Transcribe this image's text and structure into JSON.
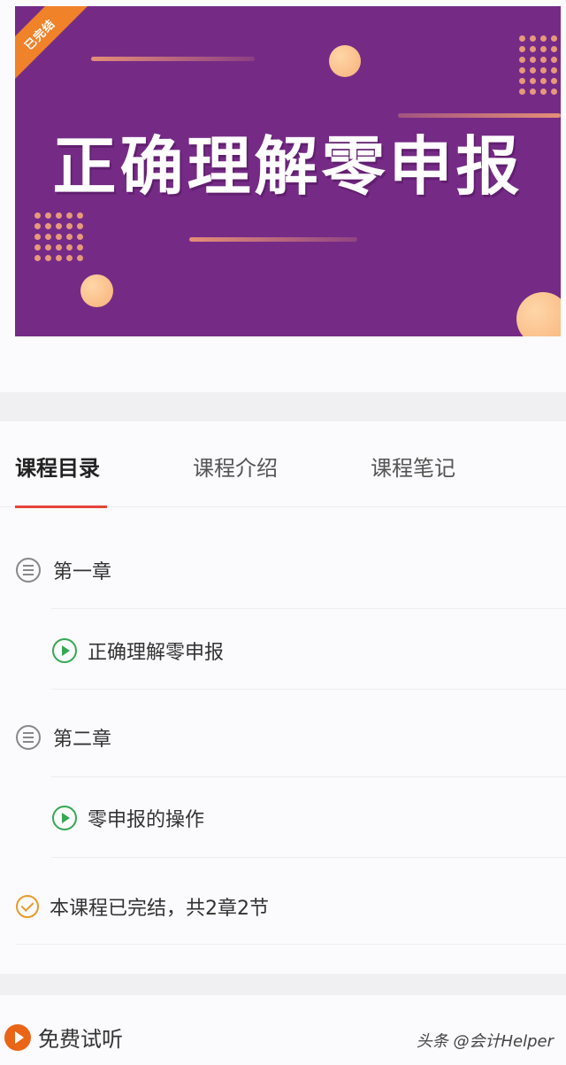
{
  "banner": {
    "corner_tag": "已完结",
    "title": "正确理解零申报"
  },
  "tabs": [
    {
      "label": "课程目录",
      "active": true
    },
    {
      "label": "课程介绍",
      "active": false
    },
    {
      "label": "课程笔记",
      "active": false
    }
  ],
  "catalog": {
    "chapter_1": "第一章",
    "lesson_1": "正确理解零申报",
    "chapter_2": "第二章",
    "lesson_2": "零申报的操作",
    "completion_note": "本课程已完结，共2章2节"
  },
  "footer": {
    "trial_label": "免费试听",
    "watermark": "头条 @会计Helper"
  },
  "colors": {
    "banner_bg": "#752b86",
    "accent_red": "#e6433a",
    "play_green": "#34a853",
    "done_orange": "#e79a2a",
    "trial_orange": "#ea6516"
  },
  "icons": {
    "chapter": "list-circle-icon",
    "lesson": "play-circle-icon",
    "completed": "check-circle-icon",
    "trial": "play-filled-icon"
  }
}
